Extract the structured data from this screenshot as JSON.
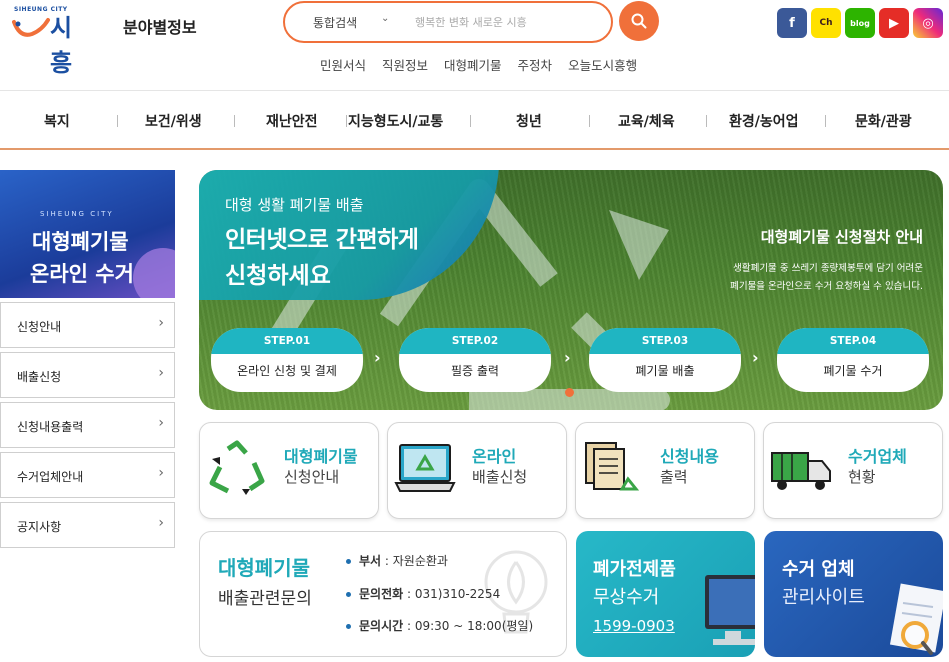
{
  "header": {
    "logo_small": "SIHEUNG CITY",
    "logo_main": "시흥",
    "section_title": "분야별정보",
    "search": {
      "category": "통합검색",
      "placeholder": "행복한 변화 새로운 시흥"
    },
    "quick_links": [
      "민원서식",
      "직원정보",
      "대형폐기물",
      "주정차",
      "오늘도시흥행"
    ],
    "social": [
      {
        "label": "f",
        "icon": "facebook-icon"
      },
      {
        "label": "Ch",
        "icon": "kakao-channel-icon"
      },
      {
        "label": "blog",
        "icon": "blog-icon"
      },
      {
        "label": "▶",
        "icon": "youtube-icon"
      },
      {
        "label": "◎",
        "icon": "instagram-icon"
      }
    ]
  },
  "nav": [
    "복지",
    "보건/위생",
    "재난안전",
    "지능형도시/교통",
    "청년",
    "교육/체육",
    "환경/농어업",
    "문화/관광"
  ],
  "sidebar": {
    "banner_city": "SIHEUNG CITY",
    "banner_line1": "대형폐기물",
    "banner_line2": "온라인 수거",
    "items": [
      "신청안내",
      "배출신청",
      "신청내용출력",
      "수거업체안내",
      "공지사항"
    ]
  },
  "hero": {
    "subtitle": "대형 생활 폐기물 배출",
    "headline1": "인터넷으로 간편하게",
    "headline2": "신청하세요",
    "right_title": "대형폐기물 신청절차 안내",
    "right_desc1": "생활폐기물 중 쓰레기 종량제봉투에 담기 어려운",
    "right_desc2": "폐기물을 온라인으로 수거 요청하실 수 있습니다.",
    "steps": [
      {
        "head": "STEP.01",
        "body": "온라인 신청 및 결제"
      },
      {
        "head": "STEP.02",
        "body": "필증 출력"
      },
      {
        "head": "STEP.03",
        "body": "폐기물 배출"
      },
      {
        "head": "STEP.04",
        "body": "폐기물 수거"
      }
    ]
  },
  "cards": [
    {
      "title": "대형폐기물",
      "sub": "신청안내",
      "icon": "recycle-icon"
    },
    {
      "title": "온라인",
      "sub": "배출신청",
      "icon": "laptop-recycle-icon"
    },
    {
      "title": "신청내용",
      "sub": "출력",
      "icon": "document-recycle-icon"
    },
    {
      "title": "수거업체",
      "sub": "현황",
      "icon": "truck-icon"
    }
  ],
  "info": {
    "title": "대형폐기물",
    "sub": "배출관련문의",
    "rows": [
      {
        "label": "부서",
        "value": " : 자원순환과"
      },
      {
        "label": "문의전화",
        "value": " : 031)310-2254"
      },
      {
        "label": "문의시간",
        "value": " : 09:30 ~ 18:00(평일)"
      }
    ]
  },
  "tel_card": {
    "line1": "폐가전제품",
    "line2": "무상수거",
    "phone": "1599-0903"
  },
  "site_card": {
    "line1": "수거 업체",
    "line2": "관리사이트"
  },
  "colors": {
    "accent": "#f0703a",
    "teal": "#1fa9b8",
    "navy": "#1b4fa1"
  }
}
